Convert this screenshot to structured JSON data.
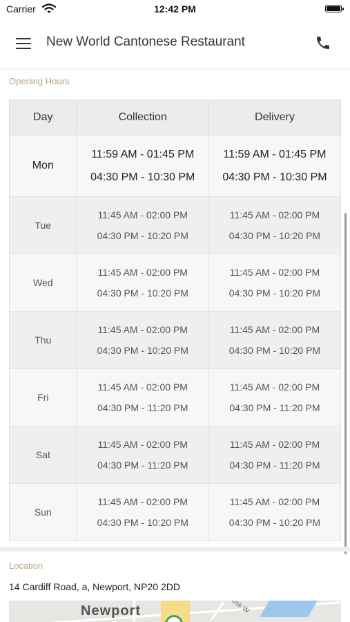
{
  "status_bar": {
    "carrier": "Carrier",
    "time": "12:42 PM"
  },
  "header": {
    "title": "New World Cantonese Restaurant"
  },
  "opening_hours": {
    "label": "Opening Hours",
    "columns": [
      "Day",
      "Collection",
      "Delivery"
    ],
    "rows": [
      {
        "day": "Mon",
        "collection": [
          "11:59 AM - 01:45 PM",
          "04:30 PM - 10:30 PM"
        ],
        "delivery": [
          "11:59 AM - 01:45 PM",
          "04:30 PM - 10:30 PM"
        ]
      },
      {
        "day": "Tue",
        "collection": [
          "11:45 AM - 02:00 PM",
          "04:30 PM - 10:20 PM"
        ],
        "delivery": [
          "11:45 AM - 02:00 PM",
          "04:30 PM - 10:20 PM"
        ]
      },
      {
        "day": "Wed",
        "collection": [
          "11:45 AM - 02:00 PM",
          "04:30 PM - 10:20 PM"
        ],
        "delivery": [
          "11:45 AM - 02:00 PM",
          "04:30 PM - 10:20 PM"
        ]
      },
      {
        "day": "Thu",
        "collection": [
          "11:45 AM - 02:00 PM",
          "04:30 PM - 10:20 PM"
        ],
        "delivery": [
          "11:45 AM - 02:00 PM",
          "04:30 PM - 10:20 PM"
        ]
      },
      {
        "day": "Fri",
        "collection": [
          "11:45 AM - 02:00 PM",
          "04:30 PM - 11:20 PM"
        ],
        "delivery": [
          "11:45 AM - 02:00 PM",
          "04:30 PM - 11:20 PM"
        ]
      },
      {
        "day": "Sat",
        "collection": [
          "11:45 AM - 02:00 PM",
          "04:30 PM - 11:20 PM"
        ],
        "delivery": [
          "11:45 AM - 02:00 PM",
          "04:30 PM - 11:20 PM"
        ]
      },
      {
        "day": "Sun",
        "collection": [
          "11:45 AM - 02:00 PM",
          "04:30 PM - 10:20 PM"
        ],
        "delivery": [
          "11:45 AM - 02:00 PM",
          "04:30 PM - 10:20 PM"
        ]
      }
    ]
  },
  "location": {
    "label": "Location",
    "address": "14 Cardiff Road, a, Newport, NP20 2DD",
    "map": {
      "place_label": "Newport",
      "street_label": "Usk W"
    }
  },
  "colors": {
    "accent_label": "#b8a582",
    "pin": "#3ba84a",
    "water": "#9cc8ee"
  },
  "icons": {
    "menu": "hamburger-menu-icon",
    "call": "phone-icon",
    "wifi": "wifi-icon",
    "battery": "battery-icon"
  }
}
